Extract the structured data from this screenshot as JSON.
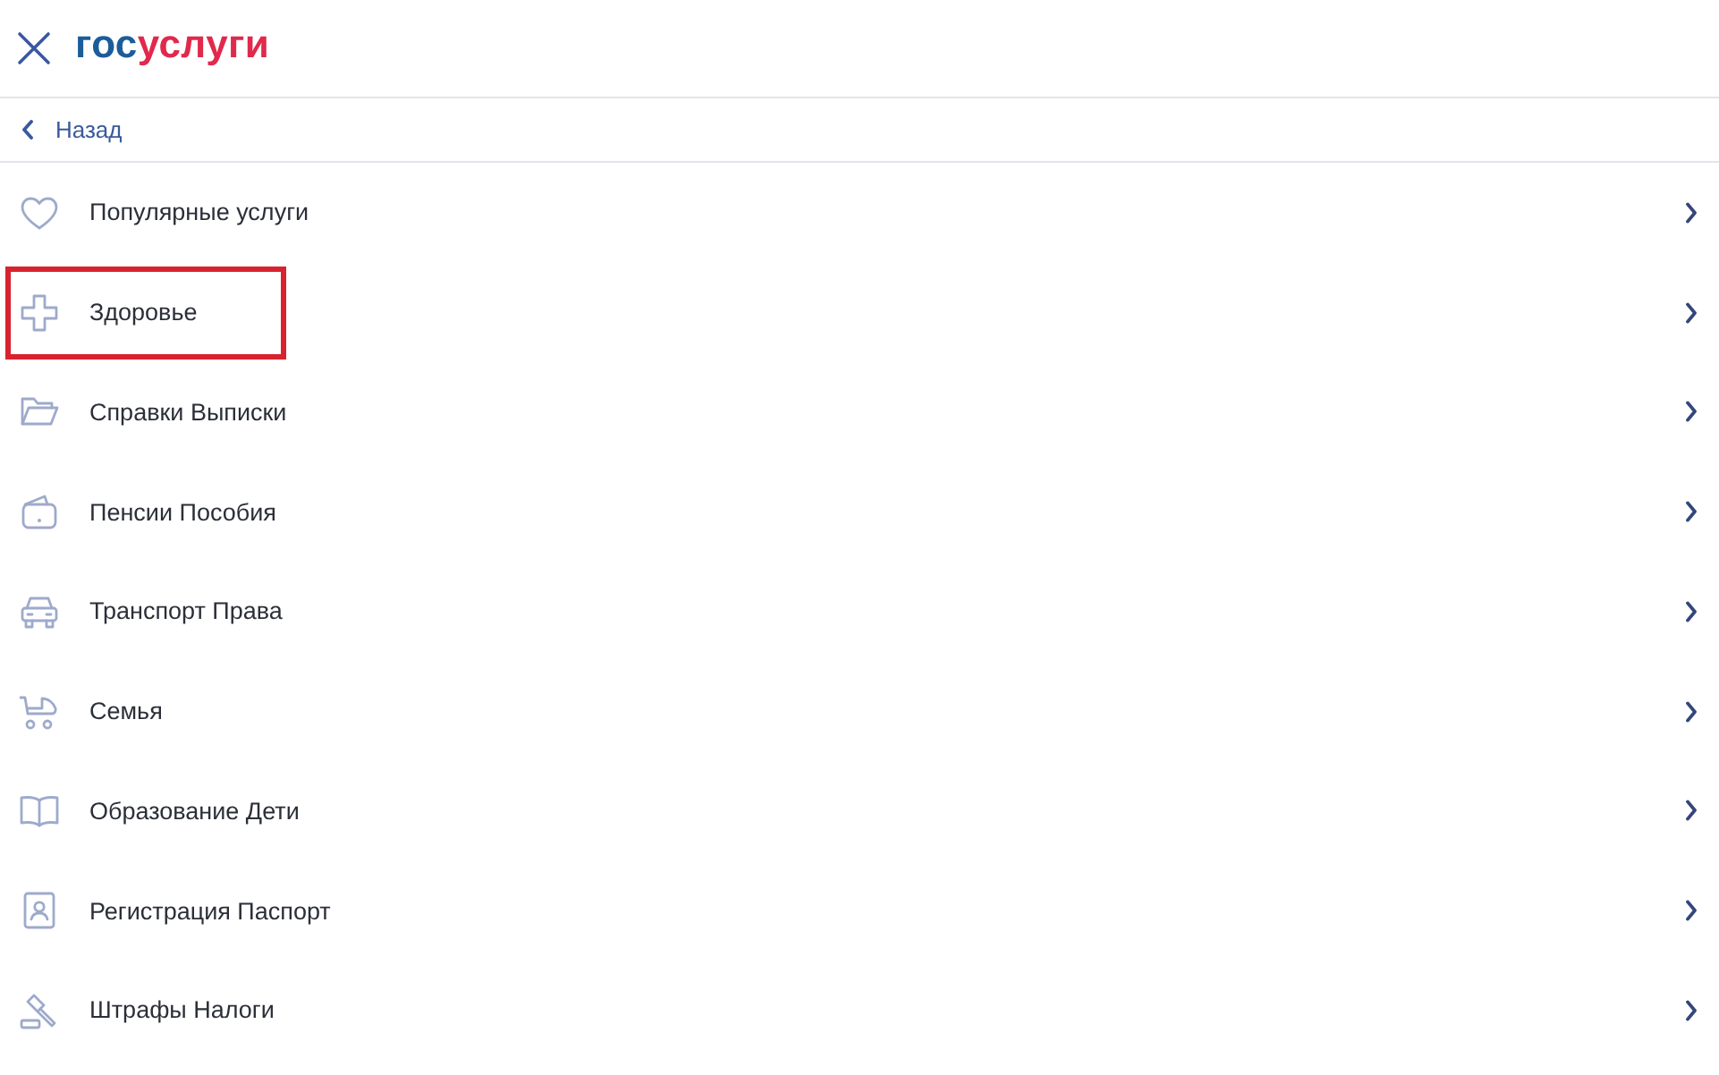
{
  "header": {
    "logo": [
      "гос",
      "услуги"
    ]
  },
  "back_link": {
    "label": "Назад"
  },
  "menu": {
    "items": [
      {
        "label": "Популярные услуги",
        "highlighted": false
      },
      {
        "label": "Здоровье",
        "highlighted": true
      },
      {
        "label": "Справки Выписки",
        "highlighted": false
      },
      {
        "label": "Пенсии Пособия",
        "highlighted": false
      },
      {
        "label": "Транспорт Права",
        "highlighted": false
      },
      {
        "label": "Семья",
        "highlighted": false
      },
      {
        "label": "Образование Дети",
        "highlighted": false
      },
      {
        "label": "Регистрация Паспорт",
        "highlighted": false
      },
      {
        "label": "Штрафы Налоги",
        "highlighted": false
      }
    ]
  }
}
